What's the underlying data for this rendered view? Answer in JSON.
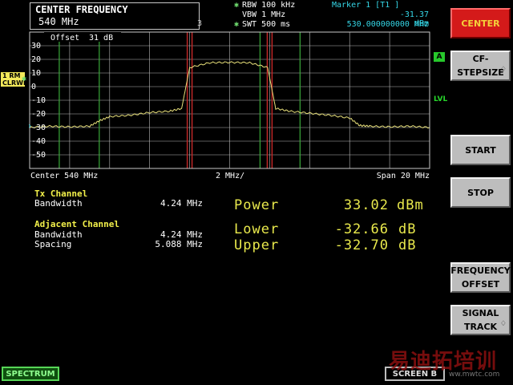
{
  "header": {
    "cf_title": "CENTER FREQUENCY",
    "cf_value": "540 MHz",
    "rbw": "RBW 100 kHz",
    "vbw": "VBW 1 MHz",
    "swt": "SWT 500 ms",
    "marker_label": "Marker 1 [T1 ]",
    "marker_level": "-31.37 dBm",
    "marker_freq": "530.000000000 MHz",
    "offset_label": "Offset",
    "offset_value": "31 dB",
    "trace_tag": "1 RM\nCLRWR",
    "a_tag": "A",
    "lvl_tag": "LVL",
    "ref_char": "3",
    "b_char": "B"
  },
  "axis": {
    "y_labels": [
      "30",
      "20",
      "10",
      "0",
      "-10",
      "-20",
      "-30",
      "-40",
      "-50"
    ],
    "center_label": "Center 540 MHz",
    "div_label": "2 MHz/",
    "span_label": "Span 20 MHz"
  },
  "measurement": {
    "tx_title": "Tx Channel",
    "tx_bw_label": "Bandwidth",
    "tx_bw_value": "4.24 MHz",
    "adj_title": "Adjacent Channel",
    "adj_bw_label": "Bandwidth",
    "adj_bw_value": "4.24 MHz",
    "spacing_label": "Spacing",
    "spacing_value": "5.088 MHz",
    "power_label": "Power",
    "power_value": "33.02",
    "power_unit": "dBm",
    "lower_label": "Lower",
    "lower_value": "-32.66",
    "lower_unit": "dB",
    "upper_label": "Upper",
    "upper_value": "-32.70",
    "upper_unit": "dB"
  },
  "softkeys": [
    {
      "label": "CENTER",
      "active": true,
      "arrow": ""
    },
    {
      "label": "CF-\nSTEPSIZE",
      "active": false,
      "arrow": "♢"
    },
    {
      "label": "START",
      "active": false,
      "arrow": ""
    },
    {
      "label": "STOP",
      "active": false,
      "arrow": ""
    },
    {
      "label": "FREQUENCY\nOFFSET",
      "active": false,
      "arrow": ""
    },
    {
      "label": "SIGNAL\nTRACK",
      "active": false,
      "arrow": "♢"
    }
  ],
  "footer": {
    "spectrum": "SPECTRUM",
    "screen_b": "SCREEN B",
    "watermark": "易迪拓培训",
    "watermark_sub": "ww.mwtc.com"
  },
  "colors": {
    "trace": "#e8e07a",
    "grid": "#b9b9b9",
    "channel_line_green": "#3aa83a",
    "channel_line_red": "#c62828",
    "active_key": "#d41a1a"
  },
  "chart_data": {
    "type": "line",
    "title": "",
    "xlabel": "",
    "ylabel": "",
    "x_unit": "MHz",
    "xlim": [
      530,
      550
    ],
    "ylim": [
      -60,
      30
    ],
    "grid": true,
    "y_ticks": [
      30,
      20,
      10,
      0,
      -10,
      -20,
      -30,
      -40,
      -50
    ],
    "channel_lines_green_mhz": [
      531.48,
      533.48,
      541.52,
      543.52
    ],
    "channel_lines_red_mhz": [
      537.88,
      538.12,
      541.88,
      542.12
    ],
    "series": [
      {
        "x": [
          530,
          531,
          532,
          533,
          533.5,
          534,
          535,
          536,
          537,
          537.6,
          538,
          539,
          540,
          541,
          541.9,
          542.3,
          543,
          544,
          545,
          546,
          546.5,
          547,
          548,
          549,
          550
        ],
        "y": [
          -30,
          -29,
          -29.5,
          -29,
          -25,
          -22,
          -21,
          -19,
          -18,
          -16,
          14,
          17.5,
          17.8,
          17.5,
          14,
          -16,
          -18,
          -19.5,
          -21,
          -23,
          -28.5,
          -29,
          -29.5,
          -29,
          -30
        ]
      }
    ]
  }
}
